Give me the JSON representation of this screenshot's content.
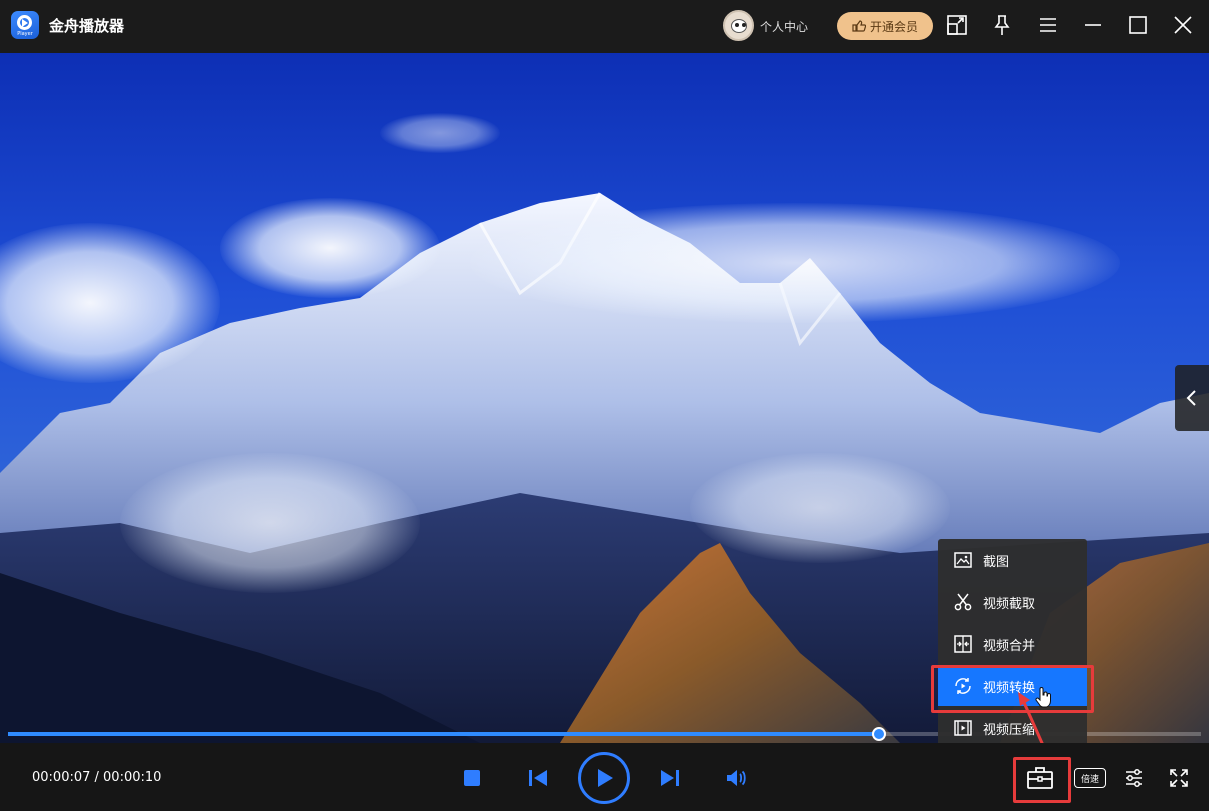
{
  "titlebar": {
    "app_name": "金舟播放器",
    "logo_sub": "Player",
    "user_center": "个人中心",
    "vip_label": "开通会员",
    "icons": [
      "screen-cast-icon",
      "pin-icon",
      "menu-icon",
      "minimize-icon",
      "maximize-icon",
      "close-icon"
    ]
  },
  "player": {
    "time_text": "00:00:07 / 00:00:10",
    "progress": 0.73,
    "speed_label": "倍速"
  },
  "tools_menu": {
    "items": [
      {
        "label": "截图",
        "icon": "screenshot-icon"
      },
      {
        "label": "视频截取",
        "icon": "scissors-icon"
      },
      {
        "label": "视频合并",
        "icon": "merge-icon"
      },
      {
        "label": "视频转换",
        "icon": "convert-icon",
        "active": true
      },
      {
        "label": "视频压缩",
        "icon": "compress-icon"
      }
    ]
  },
  "colors": {
    "accent": "#1677ff",
    "highlight": "#e63b3b",
    "vip": "#f0c28c"
  }
}
